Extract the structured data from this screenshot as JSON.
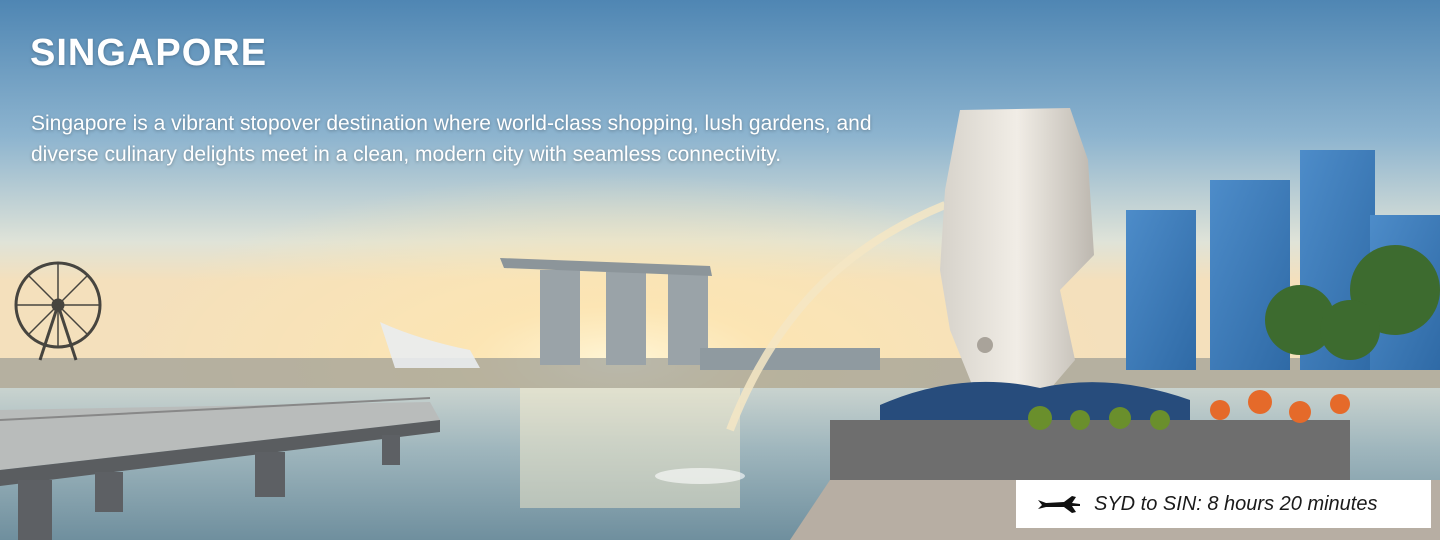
{
  "destination": {
    "title": "SINGAPORE",
    "description": "Singapore is a vibrant stopover destination where world-class shopping, lush gardens, and diverse culinary delights meet in a clean, modern city with seamless connectivity."
  },
  "flight": {
    "icon": "airplane-icon",
    "text": "SYD to SIN: 8 hours 20 minutes"
  },
  "colors": {
    "sky_top": "#5a8fb8",
    "horizon_glow": "#f6e3c0",
    "water": "#8aa9b8",
    "text": "#ffffff"
  }
}
